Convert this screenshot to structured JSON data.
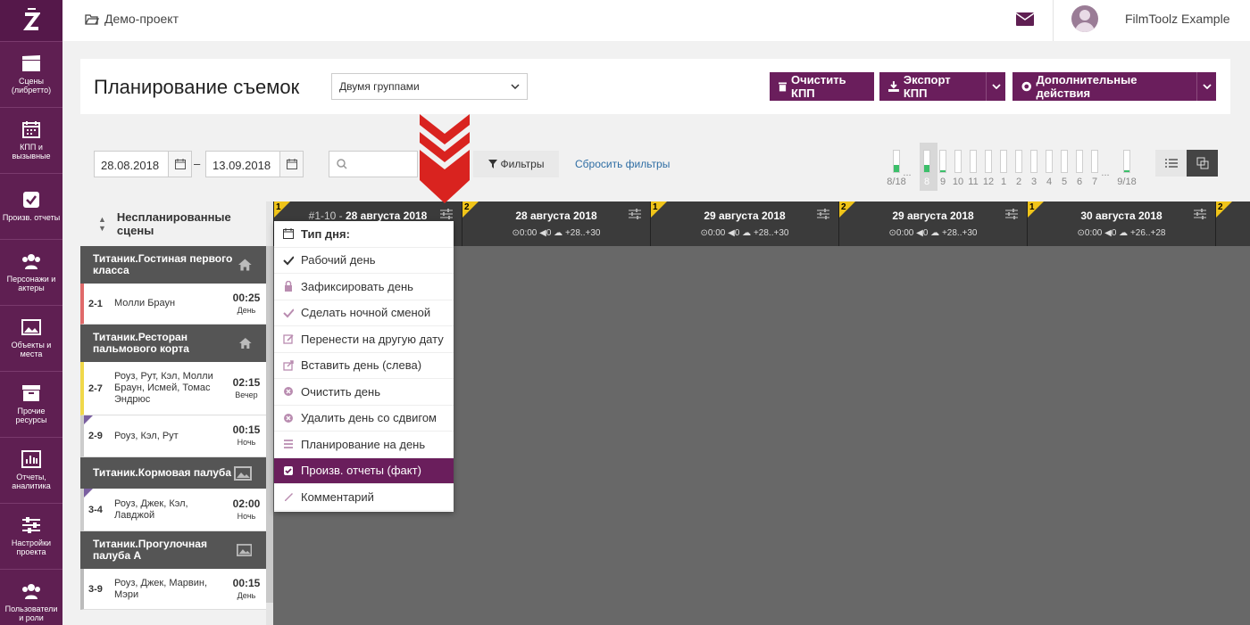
{
  "sidebar": {
    "items": [
      {
        "label": "Сцены (либретто)",
        "icon": "clapperboard-icon"
      },
      {
        "label": "КПП и вызывные",
        "icon": "calendar-icon"
      },
      {
        "label": "Произв. отчеты",
        "icon": "checkbox-icon"
      },
      {
        "label": "Персонажи и актеры",
        "icon": "people-icon"
      },
      {
        "label": "Объекты и места",
        "icon": "image-icon"
      },
      {
        "label": "Прочие ресурсы",
        "icon": "box-icon"
      },
      {
        "label": "Отчеты, аналитика",
        "icon": "bar-chart-icon"
      },
      {
        "label": "Настройки проекта",
        "icon": "sliders-icon"
      },
      {
        "label": "Пользователи и роли",
        "icon": "users-icon"
      }
    ]
  },
  "topbar": {
    "project": "Демо-проект",
    "user": "FilmToolz Example"
  },
  "header": {
    "title": "Планирование съемок",
    "group_select": "Двумя группами",
    "btn_clear": "Очистить КПП",
    "btn_export": "Экспорт КПП",
    "btn_more": "Дополнительные действия"
  },
  "filters": {
    "date_from": "28.08.2018",
    "date_to": "13.09.2018",
    "dash": "–",
    "filter_btn": "Фильтры",
    "reset": "Сбросить фильтры"
  },
  "mini": {
    "labels": [
      "8/18",
      "8",
      "9",
      "10",
      "11",
      "12",
      "1",
      "2",
      "3",
      "4",
      "5",
      "6",
      "7",
      "9/18"
    ],
    "dots": "...",
    "fills": [
      0.35,
      0.35,
      0.08,
      0,
      0,
      0,
      0,
      0,
      0,
      0,
      0,
      0,
      0,
      0.08
    ]
  },
  "unplanned": {
    "title": "Неспланированные сцены",
    "groups": [
      {
        "name": "Титаник.Гостиная первого класса",
        "icon": "home-icon",
        "scenes": [
          {
            "num": "2-1",
            "names": "Молли Браун",
            "time": "00:25",
            "tod": "День",
            "color": "#e06a6a",
            "corner": false
          }
        ]
      },
      {
        "name": "Титаник.Ресторан пальмового корта",
        "icon": "home-icon",
        "scenes": [
          {
            "num": "2-7",
            "names": "Роуз, Рут, Кэл, Молли Браун, Исмей, Томас Эндрюс",
            "time": "02:15",
            "tod": "Вечер",
            "color": "#f0d84a",
            "corner": false
          },
          {
            "num": "2-9",
            "names": "Роуз, Кэл, Рут",
            "time": "00:15",
            "tod": "Ночь",
            "color": "#ccc",
            "corner": true
          }
        ]
      },
      {
        "name": "Титаник.Кормовая палуба",
        "icon": "landscape-icon",
        "scenes": [
          {
            "num": "3-4",
            "names": "Роуз, Джек, Кэл, Лавджой",
            "time": "02:00",
            "tod": "Ночь",
            "color": "#ccc",
            "corner": true
          }
        ]
      },
      {
        "name": "Титаник.Прогулочная палуба А",
        "icon": "landscape-icon",
        "scenes": [
          {
            "num": "3-9",
            "names": "Роуз, Джек, Марвин, Мэри",
            "time": "00:15",
            "tod": "День",
            "color": "#bbb",
            "corner": false
          }
        ]
      }
    ]
  },
  "days": [
    {
      "n": "1",
      "title": "#1-10 - 28 августа 2018",
      "prefix": "#1-10 - ",
      "date": "28 августа 2018",
      "meta": ""
    },
    {
      "n": "2",
      "title": "28 августа 2018",
      "meta": "⊙0:00  ◀0  ☁ +28..+30"
    },
    {
      "n": "1",
      "title": "29 августа 2018",
      "meta": "⊙0:00  ◀0  ☁ +28..+30"
    },
    {
      "n": "2",
      "title": "29 августа 2018",
      "meta": "⊙0:00  ◀0  ☁ +28..+30"
    },
    {
      "n": "1",
      "title": "30 августа 2018",
      "meta": "⊙0:00  ◀0  ☁ +26..+28"
    },
    {
      "n": "2",
      "title": "",
      "meta": ""
    }
  ],
  "menu": {
    "header": "Тип дня:",
    "items": [
      {
        "label": "Рабочий день",
        "icon": "check-icon"
      },
      {
        "label": "Зафиксировать день",
        "icon": "lock-icon"
      },
      {
        "label": "Сделать ночной сменой",
        "icon": "check-icon"
      },
      {
        "label": "Перенести на другую дату",
        "icon": "edit-icon"
      },
      {
        "label": "Вставить день (слева)",
        "icon": "share-icon"
      },
      {
        "label": "Очистить день",
        "icon": "clear-icon"
      },
      {
        "label": "Удалить день со сдвигом",
        "icon": "remove-icon"
      },
      {
        "label": "Планирование на день",
        "icon": "list-icon"
      },
      {
        "label": "Произв. отчеты (факт)",
        "icon": "checkbox-icon"
      },
      {
        "label": "Комментарий",
        "icon": "pencil-icon"
      }
    ]
  }
}
